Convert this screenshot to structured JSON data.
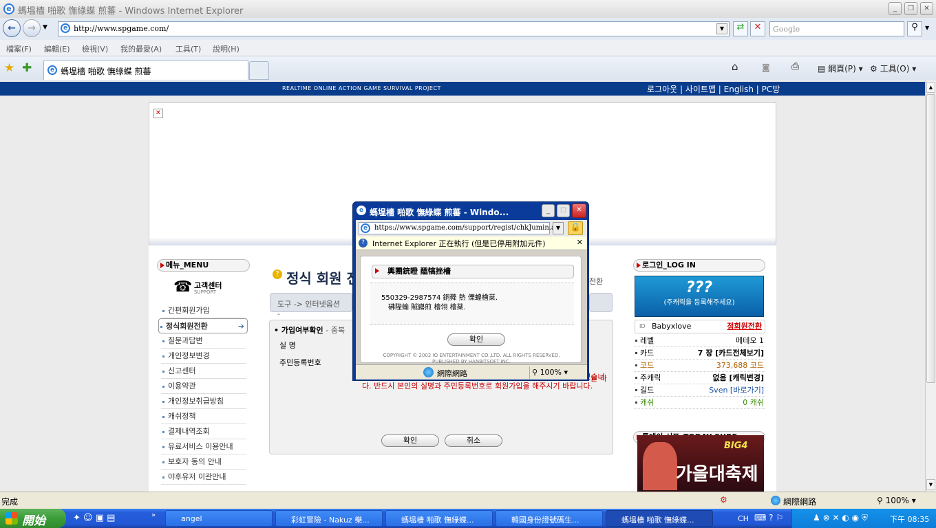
{
  "browser": {
    "window_title": "螞塭檣 啪歌 憮綠蝶 煎蕃 - Windows Internet Explorer",
    "address": "http://www.spgame.com/",
    "search_placeholder": "Google",
    "menu": [
      "檔案(F)",
      "編輯(E)",
      "檢視(V)",
      "我的最愛(A)",
      "工具(T)",
      "說明(H)"
    ],
    "tab_label": "螞塭檣 啪歌 憮綠蝶 煎蕃",
    "toolbar_page": "網頁(P)",
    "toolbar_tools": "工具(O)",
    "status_text": "完成",
    "zone": "網際網路",
    "zoom": "100%"
  },
  "site": {
    "slogan": "REALTIME ONLINE ACTION GAME SURVIVAL PROJECT",
    "top_links": "로그아웃 | 사이트맵 | English | PC방",
    "menu_header": "메뉴_MENU",
    "support_title": "고객센터",
    "support_sub": "SUPPORT",
    "left_menu": [
      "간편회원가입",
      "정식회원전환",
      "질문과답변",
      "개인정보변경",
      "신고센터",
      "이용약관",
      "개인정보취급방침",
      "캐쉬정책",
      "결제내역조회",
      "유료서비스 이용안내",
      "보호자 동의 안내",
      "야후유저 이관안내"
    ],
    "page_title": "정식 회원 전",
    "page_title_right": "전환",
    "breadcrumb": "도구 -> 인터넷옵션 -",
    "section_label": "가입여부확인",
    "section_suffix": "- 중복",
    "field_name": "실 명",
    "field_jumin": "주민등록번호",
    "warning_suffix": "을 하",
    "warning": "는 행위는 주민등록법 등에 의거 3년 이하 징역 또는 벌금에 처해질 수 있습니다. 반드시 본인의 실명과 주민등록번호로 회원가입을 해주시기 바랍니다.",
    "confirm_label": "확인",
    "cancel_label": "취소",
    "login_header": "로그인_LOG IN",
    "avatar_text": "???",
    "avatar_sub": "(주캐릭을 등록해주세요)",
    "user_id": "Babyxlove",
    "member_convert": "정회원전환",
    "stats": [
      {
        "label": "레벨",
        "value": "메테오 1"
      },
      {
        "label": "카드",
        "value": "7 장 [카드전체보기]"
      },
      {
        "label": "코드",
        "value": "373,688 코드"
      },
      {
        "label": "주캐릭",
        "value": "없음 [캐릭변경]"
      },
      {
        "label": "길드",
        "value": "Sven [바로가기]"
      },
      {
        "label": "캐쉬",
        "value": "0 캐쉬"
      }
    ],
    "today_header": "투데이 서프_TODAY SURF",
    "promo_text": "가을대축제",
    "promo_badge": "BIG4"
  },
  "popup": {
    "title": "螞塭檣 啪歌 憮綠蝶 煎蕃 - Windo...",
    "address": "https://www.spgame.com/support/regist/chkJumin.asp",
    "infobar": "Internet Explorer 正在執行 (但是已停用附加元件)",
    "box_title": "輿團銃瞪 醞犒挫檣",
    "message_line1": "550329-2987574 銅蕣  熱 傈蝗檜棻.",
    "message_line2": "砩陛蝓 賊巋煎 檜翎 檜棻.",
    "confirm_label": "확인",
    "copyright": "COPYRIGHT © 2002 IO ENTERTAINMENT CO.,LTD. ALL RIGHTS RESERVED.",
    "publisher": "PUBLISHED BY HANBITSOFT INC.",
    "zone": "網際網路",
    "zoom": "100%"
  },
  "taskbar": {
    "start_label": "開始",
    "tasks": [
      "angel",
      "彩虹冒險 - Nakuz 樂...",
      "螞塭檣 啪歌 憮綠蝶...",
      "韓國身份證號碼生...",
      "螞塭檣 啪歌 憮綠蝶..."
    ],
    "lang": "CH",
    "clock": "下午 08:35"
  }
}
